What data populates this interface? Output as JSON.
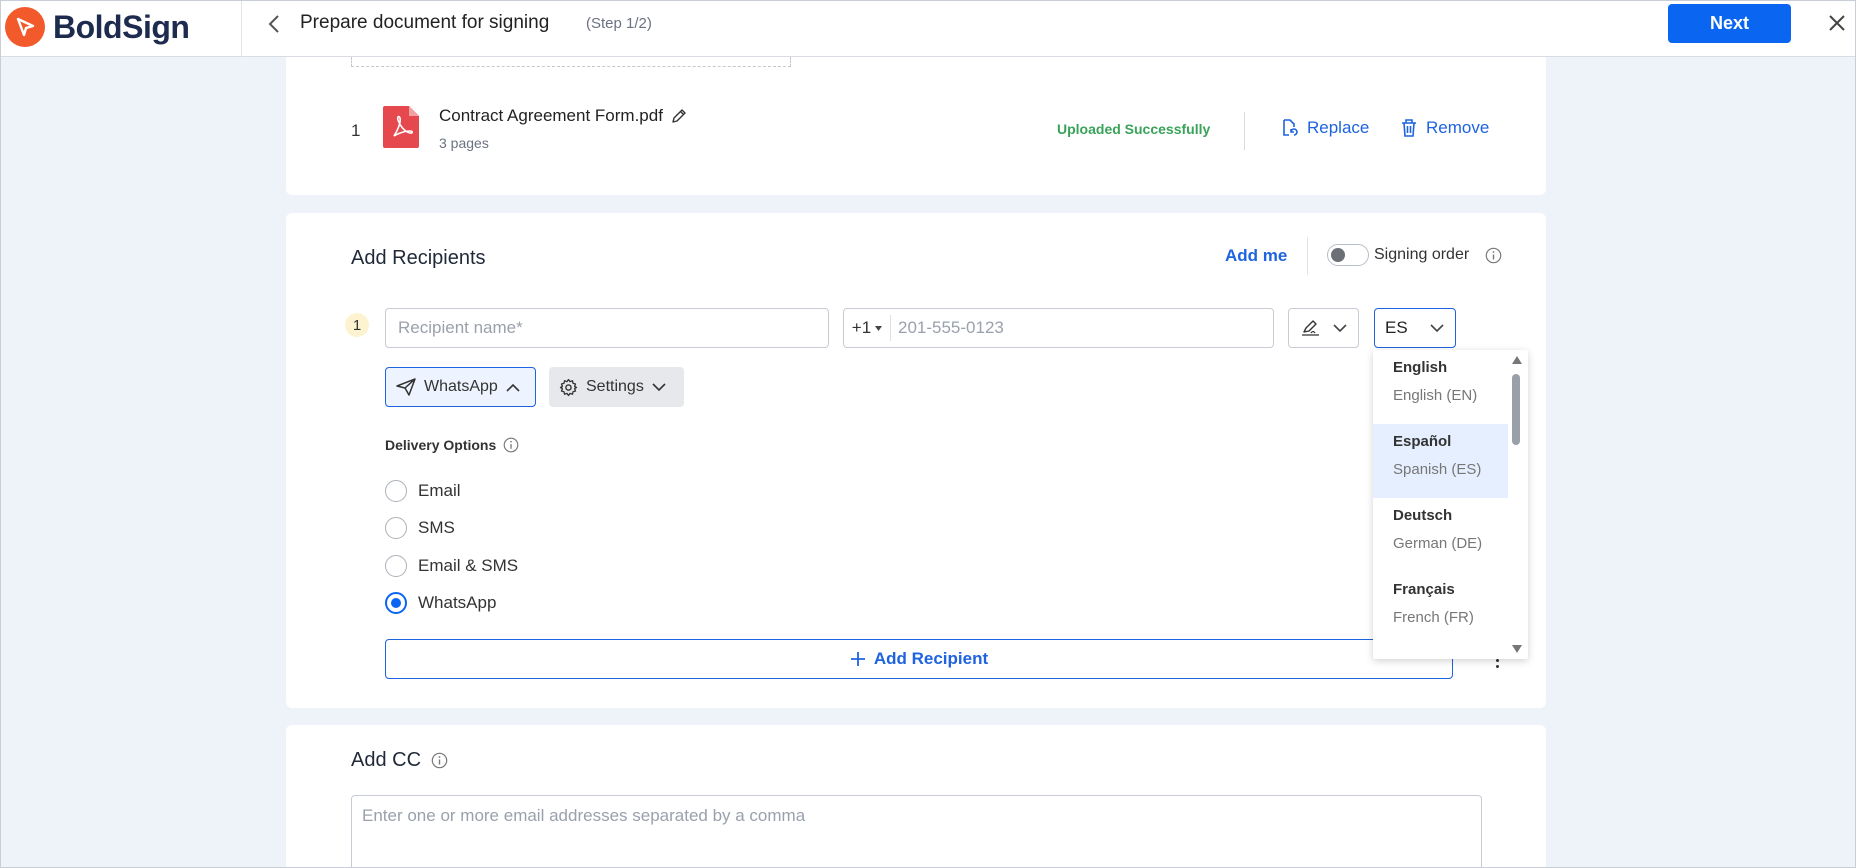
{
  "header": {
    "logo_text": "BoldSign",
    "title": "Prepare document for signing",
    "step": "(Step 1/2)",
    "next_label": "Next",
    "icons": {
      "back": "chevron-left-icon",
      "close": "close-icon"
    }
  },
  "file": {
    "index": "1",
    "name": "Contract Agreement Form.pdf",
    "pages": "3 pages",
    "status": "Uploaded Successfully",
    "replace_label": "Replace",
    "remove_label": "Remove"
  },
  "recipients": {
    "title": "Add Recipients",
    "add_me_label": "Add me",
    "signing_order_label": "Signing order",
    "signing_order_enabled": false,
    "recipient": {
      "index": "1",
      "name_placeholder": "Recipient name*",
      "phone_code": "+1",
      "phone_placeholder": "201-555-0123",
      "language_value": "ES",
      "delivery_button_label": "WhatsApp",
      "settings_button_label": "Settings"
    },
    "delivery_options_label": "Delivery Options",
    "delivery_options": [
      "Email",
      "SMS",
      "Email & SMS",
      "WhatsApp"
    ],
    "selected_delivery": "WhatsApp",
    "add_recipient_label": "Add Recipient"
  },
  "cc": {
    "title": "Add CC",
    "placeholder": "Enter one or more email addresses separated by a comma"
  },
  "language_menu": {
    "options": [
      {
        "name": "English",
        "sub": "English (EN)"
      },
      {
        "name": "Español",
        "sub": "Spanish (ES)"
      },
      {
        "name": "Deutsch",
        "sub": "German (DE)"
      },
      {
        "name": "Français",
        "sub": "French (FR)"
      }
    ],
    "selected": "Español"
  },
  "colors": {
    "primary": "#0a66f0",
    "link": "#1e63e0",
    "success": "#3aa35a",
    "brand_orange": "#f2592b",
    "pdf_red": "#e5484d",
    "page_bg": "#eef2f9"
  }
}
